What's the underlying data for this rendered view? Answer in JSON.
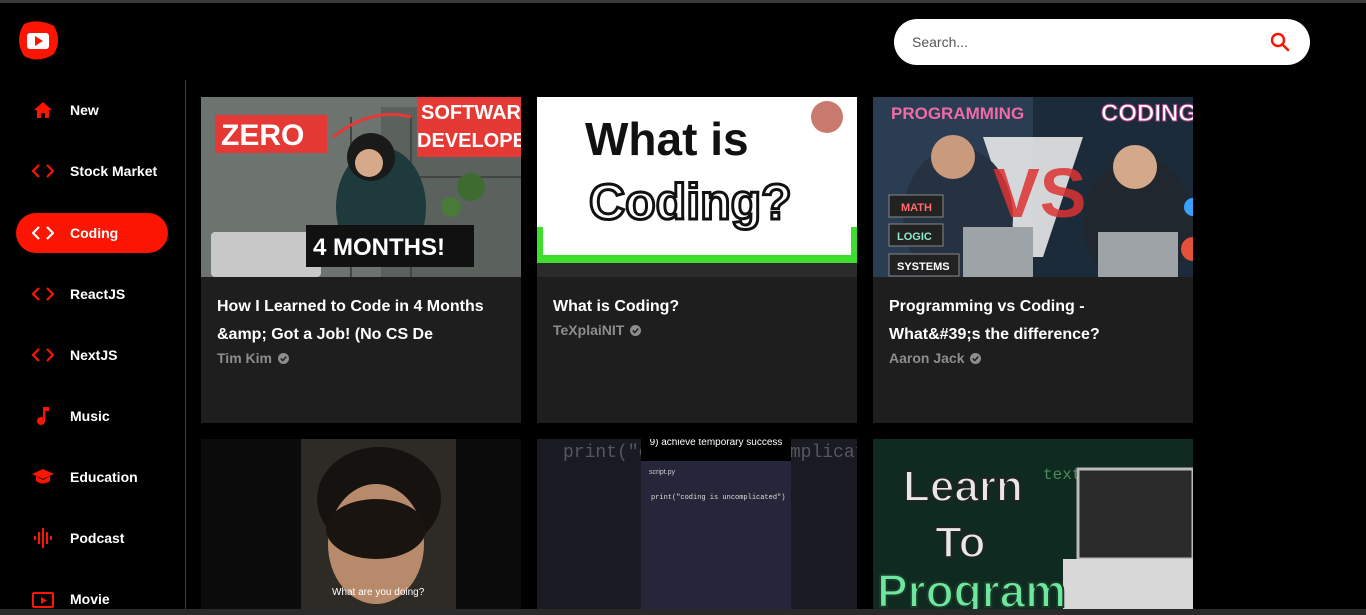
{
  "search": {
    "placeholder": "Search..."
  },
  "categories": [
    {
      "label": "New",
      "icon": "home-icon"
    },
    {
      "label": "Stock Market",
      "icon": "code-icon"
    },
    {
      "label": "Coding",
      "icon": "code-icon",
      "active": true
    },
    {
      "label": "ReactJS",
      "icon": "code-icon"
    },
    {
      "label": "NextJS",
      "icon": "code-icon"
    },
    {
      "label": "Music",
      "icon": "music-note-icon"
    },
    {
      "label": "Education",
      "icon": "graduation-cap-icon"
    },
    {
      "label": "Podcast",
      "icon": "graphic-eq-icon"
    },
    {
      "label": "Movie",
      "icon": "live-tv-icon"
    }
  ],
  "videos": [
    {
      "title": "How I Learned to Code in 4 Months &amp; Got a Job! (No CS De",
      "channel": "Tim Kim",
      "thumb_text": {
        "left": "ZERO",
        "right": "SOFTWARE",
        "right2": "DEVELOPER",
        "badge": "4 MONTHS!"
      }
    },
    {
      "title": "What is Coding?",
      "channel": "TeXplaiNIT",
      "thumb_text": {
        "line1": "What is",
        "line2": "Coding?"
      }
    },
    {
      "title": "Programming vs Coding - What&#39;s the difference?",
      "channel": "Aaron Jack",
      "thumb_text": {
        "left": "PROGRAMMING",
        "right": "CODING",
        "vs": "VS",
        "tags": [
          "MATH",
          "LOGIC",
          "SYSTEMS"
        ]
      }
    },
    {
      "thumb_text": {
        "caption": "What are you doing?"
      }
    },
    {
      "thumb_text": {
        "bg_code": "print(\"coding is uncomplicated\")",
        "caption": "9) achieve temporary success",
        "file": "script.py",
        "code": "print(\"coding is uncomplicated\")"
      }
    },
    {
      "thumb_text": {
        "line1": "Learn",
        "line2": "To",
        "line3": "Program",
        "bg": "text/javascript"
      }
    }
  ],
  "colors": {
    "accent": "#fc1503",
    "card_bg": "#1e1e1e",
    "channel_text": "#8d8d8d"
  }
}
